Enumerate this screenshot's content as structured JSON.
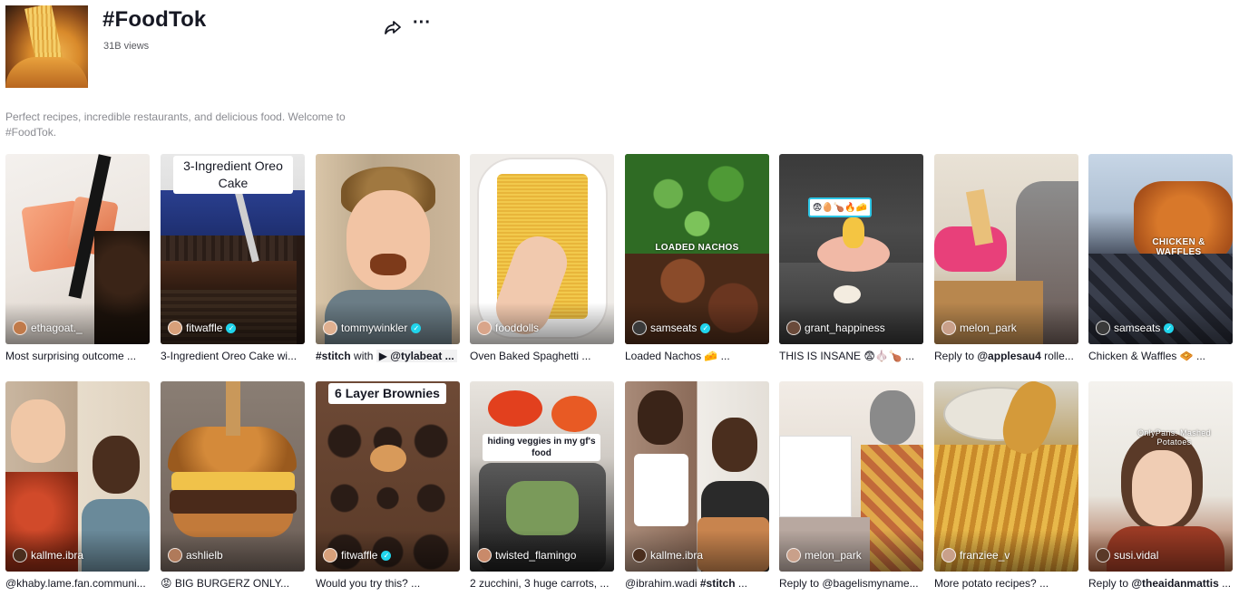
{
  "hashtag": {
    "title": "#FoodTok",
    "views": "31B views",
    "description": "Perfect recipes, incredible restaurants, and delicious food. Welcome to #FoodTok.",
    "cover_icon": "noodle-bowl-image",
    "share_icon": "share-arrow-icon",
    "more_icon": "more-dots-icon"
  },
  "videos": [
    {
      "author": "ethagoat._",
      "verified": false,
      "caption": "Most surprising outcome ..."
    },
    {
      "author": "fitwaffle",
      "verified": true,
      "caption": "3-Ingredient Oreo Cake wi...",
      "sticker": "3-Ingredient Oreo Cake"
    },
    {
      "author": "tommywinkler",
      "verified": true,
      "caption_prefix": "#stitch",
      "caption_mid": " with ",
      "caption_mention": "▶ @tylabeat ..."
    },
    {
      "author": "fooddolls",
      "verified": false,
      "caption": "Oven Baked Spaghetti ..."
    },
    {
      "author": "samseats",
      "verified": true,
      "caption": "Loaded Nachos 🧀 ...",
      "overlay_text": "LOADED NACHOS"
    },
    {
      "author": "grant_happiness",
      "verified": false,
      "caption": "THIS IS INSANE 😨🧄🍗 ...",
      "sticker": "😨🥚🍗🔥🧀"
    },
    {
      "author": "melon_park",
      "verified": false,
      "caption_prefix": "Reply to ",
      "caption_mention": "@applesau4",
      "caption_suffix": " rolle..."
    },
    {
      "author": "samseats",
      "verified": true,
      "caption": "Chicken & Waffles 🧇 ...",
      "overlay_text": "CHICKEN & WAFFLES"
    },
    {
      "author": "kallme.ibra",
      "verified": false,
      "caption": "@khaby.lame.fan.communi..."
    },
    {
      "author": "ashlielb",
      "verified": false,
      "caption": "😡 BIG BURGERZ ONLY..."
    },
    {
      "author": "fitwaffle",
      "verified": true,
      "caption": "Would you try this? ...",
      "sticker": "6 Layer Brownies"
    },
    {
      "author": "twisted_flamingo",
      "verified": false,
      "caption": "2 zucchini, 3 huge carrots, ...",
      "sticker": "hiding veggies in my gf's food"
    },
    {
      "author": "kallme.ibra",
      "verified": false,
      "caption_prefix": "@ibrahim.wadi ",
      "caption_mention": "#stitch",
      "caption_suffix": " ..."
    },
    {
      "author": "melon_park",
      "verified": false,
      "caption": "Reply to @bagelismyname..."
    },
    {
      "author": "franziee_v",
      "verified": false,
      "caption": "More potato recipes? ..."
    },
    {
      "author": "susi.vidal",
      "verified": false,
      "caption_prefix": "Reply to ",
      "caption_mention": "@theaidanmattis",
      "caption_suffix": " ...",
      "overlay_text": "OnlyPans: Mashed Potatoes"
    }
  ],
  "colors": {
    "verified": "#20d5ec",
    "text_primary": "#161823",
    "text_secondary": "#8a8b91"
  }
}
